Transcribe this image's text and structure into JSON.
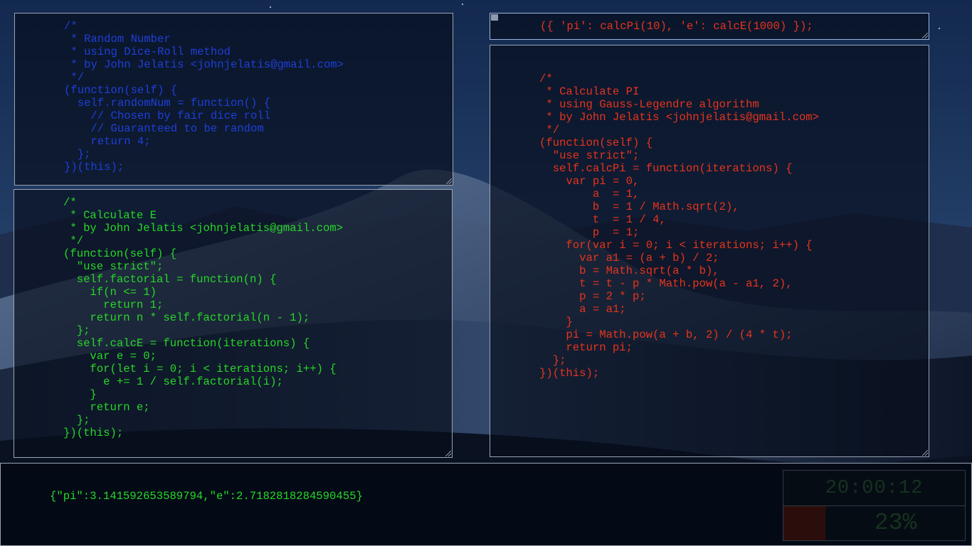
{
  "colors": {
    "random_code": "#1f3fd8",
    "e_code": "#26d826",
    "pi_code": "#e8341c",
    "output": "#26d826",
    "meter_fill": "#2b0e0b",
    "widget_text": "#15321f"
  },
  "panels": {
    "random_number": {
      "code": "/*\n * Random Number\n * using Dice-Roll method\n * by John Jelatis <johnjelatis@gmail.com>\n */\n(function(self) {\n  self.randomNum = function() {\n    // Chosen by fair dice roll\n    // Guaranteed to be random\n    return 4;\n  };\n})(this);"
    },
    "calc_e": {
      "code": "/*\n * Calculate E\n * by John Jelatis <johnjelatis@gmail.com>\n */\n(function(self) {\n  \"use strict\";\n  self.factorial = function(n) {\n    if(n <= 1)\n      return 1;\n    return n * self.factorial(n - 1);\n  };\n  self.calcE = function(iterations) {\n    var e = 0;\n    for(let i = 0; i < iterations; i++) {\n      e += 1 / self.factorial(i);\n    }\n    return e;\n  };\n})(this);"
    },
    "expression_input": {
      "value": "({ 'pi': calcPi(10), 'e': calcE(1000) });"
    },
    "calc_pi": {
      "code": "/*\n * Calculate PI\n * using Gauss-Legendre algorithm\n * by John Jelatis <johnjelatis@gmail.com>\n */\n(function(self) {\n  \"use strict\";\n  self.calcPi = function(iterations) {\n    var pi = 0,\n        a  = 1,\n        b  = 1 / Math.sqrt(2),\n        t  = 1 / 4,\n        p  = 1;\n    for(var i = 0; i < iterations; i++) {\n      var a1 = (a + b) / 2;\n      b = Math.sqrt(a * b),\n      t = t - p * Math.pow(a - a1, 2),\n      p = 2 * p;\n      a = a1;\n    }\n    pi = Math.pow(a + b, 2) / (4 * t);\n    return pi;\n  };\n})(this);"
    }
  },
  "output": {
    "text": "{\"pi\":3.141592653589794,\"e\":2.7182818284590455}"
  },
  "widget": {
    "clock": "20:00:12",
    "progress_label": "23%",
    "progress_fraction": 0.23
  }
}
